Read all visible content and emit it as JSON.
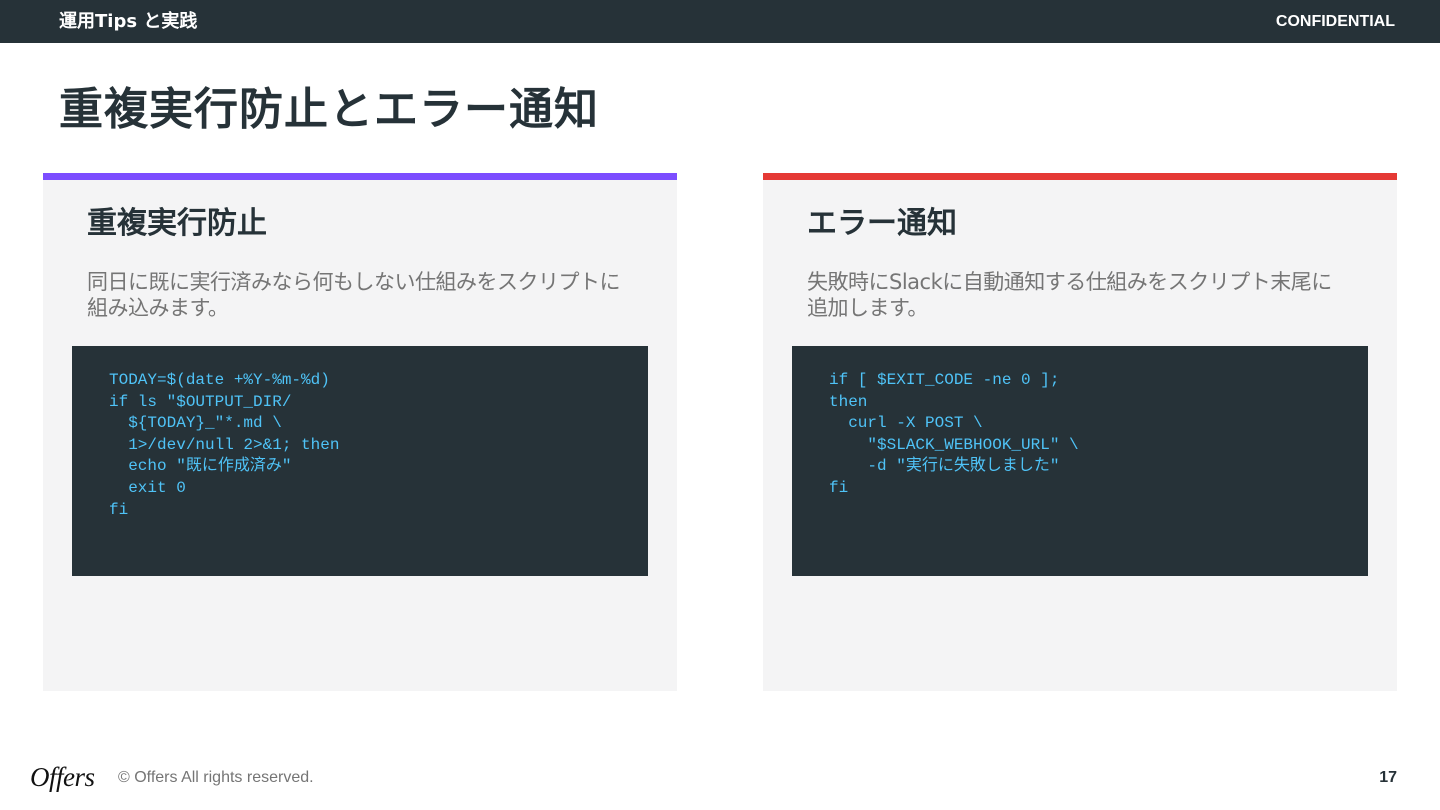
{
  "header": {
    "section_title": "運用Tips と実践",
    "confidential_label": "CONFIDENTIAL"
  },
  "slide": {
    "title": "重複実行防止とエラー通知"
  },
  "cards": [
    {
      "title": "重複実行防止",
      "description": "同日に既に実行済みなら何もしない仕組みをスクリプトに組み込みます。",
      "accent_color": "#7c4dff",
      "code": "TODAY=$(date +%Y-%m-%d)\nif ls \"$OUTPUT_DIR/\n  ${TODAY}_\"*.md \\\n  1>/dev/null 2>&1; then\n  echo \"既に作成済み\"\n  exit 0\nfi"
    },
    {
      "title": "エラー通知",
      "description": "失敗時にSlackに自動通知する仕組みをスクリプト末尾に追加します。",
      "accent_color": "#e53935",
      "code": "if [ $EXIT_CODE -ne 0 ];\nthen\n  curl -X POST \\\n    \"$SLACK_WEBHOOK_URL\" \\\n    -d \"実行に失敗しました\"\nfi"
    }
  ],
  "footer": {
    "logo_text": "Offers",
    "copyright": "© Offers All rights reserved.",
    "page_number": "17"
  },
  "colors": {
    "header_bg": "#263238",
    "card_bg": "#f4f4f5",
    "code_bg": "#263238",
    "code_text": "#4fc3f7"
  }
}
